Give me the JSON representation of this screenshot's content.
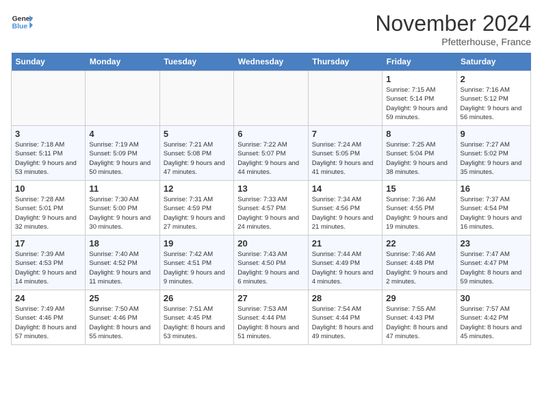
{
  "header": {
    "logo_line1": "General",
    "logo_line2": "Blue",
    "month_title": "November 2024",
    "location": "Pfetterhouse, France"
  },
  "weekdays": [
    "Sunday",
    "Monday",
    "Tuesday",
    "Wednesday",
    "Thursday",
    "Friday",
    "Saturday"
  ],
  "weeks": [
    [
      {
        "day": "",
        "info": ""
      },
      {
        "day": "",
        "info": ""
      },
      {
        "day": "",
        "info": ""
      },
      {
        "day": "",
        "info": ""
      },
      {
        "day": "",
        "info": ""
      },
      {
        "day": "1",
        "info": "Sunrise: 7:15 AM\nSunset: 5:14 PM\nDaylight: 9 hours and 59 minutes."
      },
      {
        "day": "2",
        "info": "Sunrise: 7:16 AM\nSunset: 5:12 PM\nDaylight: 9 hours and 56 minutes."
      }
    ],
    [
      {
        "day": "3",
        "info": "Sunrise: 7:18 AM\nSunset: 5:11 PM\nDaylight: 9 hours and 53 minutes."
      },
      {
        "day": "4",
        "info": "Sunrise: 7:19 AM\nSunset: 5:09 PM\nDaylight: 9 hours and 50 minutes."
      },
      {
        "day": "5",
        "info": "Sunrise: 7:21 AM\nSunset: 5:08 PM\nDaylight: 9 hours and 47 minutes."
      },
      {
        "day": "6",
        "info": "Sunrise: 7:22 AM\nSunset: 5:07 PM\nDaylight: 9 hours and 44 minutes."
      },
      {
        "day": "7",
        "info": "Sunrise: 7:24 AM\nSunset: 5:05 PM\nDaylight: 9 hours and 41 minutes."
      },
      {
        "day": "8",
        "info": "Sunrise: 7:25 AM\nSunset: 5:04 PM\nDaylight: 9 hours and 38 minutes."
      },
      {
        "day": "9",
        "info": "Sunrise: 7:27 AM\nSunset: 5:02 PM\nDaylight: 9 hours and 35 minutes."
      }
    ],
    [
      {
        "day": "10",
        "info": "Sunrise: 7:28 AM\nSunset: 5:01 PM\nDaylight: 9 hours and 32 minutes."
      },
      {
        "day": "11",
        "info": "Sunrise: 7:30 AM\nSunset: 5:00 PM\nDaylight: 9 hours and 30 minutes."
      },
      {
        "day": "12",
        "info": "Sunrise: 7:31 AM\nSunset: 4:59 PM\nDaylight: 9 hours and 27 minutes."
      },
      {
        "day": "13",
        "info": "Sunrise: 7:33 AM\nSunset: 4:57 PM\nDaylight: 9 hours and 24 minutes."
      },
      {
        "day": "14",
        "info": "Sunrise: 7:34 AM\nSunset: 4:56 PM\nDaylight: 9 hours and 21 minutes."
      },
      {
        "day": "15",
        "info": "Sunrise: 7:36 AM\nSunset: 4:55 PM\nDaylight: 9 hours and 19 minutes."
      },
      {
        "day": "16",
        "info": "Sunrise: 7:37 AM\nSunset: 4:54 PM\nDaylight: 9 hours and 16 minutes."
      }
    ],
    [
      {
        "day": "17",
        "info": "Sunrise: 7:39 AM\nSunset: 4:53 PM\nDaylight: 9 hours and 14 minutes."
      },
      {
        "day": "18",
        "info": "Sunrise: 7:40 AM\nSunset: 4:52 PM\nDaylight: 9 hours and 11 minutes."
      },
      {
        "day": "19",
        "info": "Sunrise: 7:42 AM\nSunset: 4:51 PM\nDaylight: 9 hours and 9 minutes."
      },
      {
        "day": "20",
        "info": "Sunrise: 7:43 AM\nSunset: 4:50 PM\nDaylight: 9 hours and 6 minutes."
      },
      {
        "day": "21",
        "info": "Sunrise: 7:44 AM\nSunset: 4:49 PM\nDaylight: 9 hours and 4 minutes."
      },
      {
        "day": "22",
        "info": "Sunrise: 7:46 AM\nSunset: 4:48 PM\nDaylight: 9 hours and 2 minutes."
      },
      {
        "day": "23",
        "info": "Sunrise: 7:47 AM\nSunset: 4:47 PM\nDaylight: 8 hours and 59 minutes."
      }
    ],
    [
      {
        "day": "24",
        "info": "Sunrise: 7:49 AM\nSunset: 4:46 PM\nDaylight: 8 hours and 57 minutes."
      },
      {
        "day": "25",
        "info": "Sunrise: 7:50 AM\nSunset: 4:46 PM\nDaylight: 8 hours and 55 minutes."
      },
      {
        "day": "26",
        "info": "Sunrise: 7:51 AM\nSunset: 4:45 PM\nDaylight: 8 hours and 53 minutes."
      },
      {
        "day": "27",
        "info": "Sunrise: 7:53 AM\nSunset: 4:44 PM\nDaylight: 8 hours and 51 minutes."
      },
      {
        "day": "28",
        "info": "Sunrise: 7:54 AM\nSunset: 4:44 PM\nDaylight: 8 hours and 49 minutes."
      },
      {
        "day": "29",
        "info": "Sunrise: 7:55 AM\nSunset: 4:43 PM\nDaylight: 8 hours and 47 minutes."
      },
      {
        "day": "30",
        "info": "Sunrise: 7:57 AM\nSunset: 4:42 PM\nDaylight: 8 hours and 45 minutes."
      }
    ]
  ]
}
